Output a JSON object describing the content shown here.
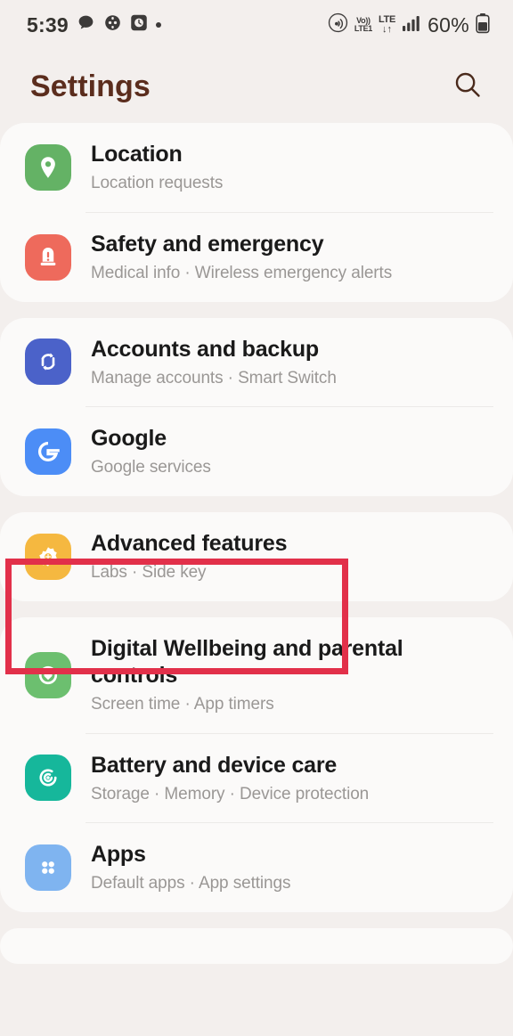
{
  "statusbar": {
    "time": "5:39",
    "left_icons": [
      "chat-bubble-icon",
      "game-controller-icon",
      "clock-app-icon",
      "dot-indicator-icon"
    ],
    "volte_top": "Vo))",
    "volte_bottom": "LTE1",
    "lte_top": "LTE",
    "lte_bottom": "↓↑",
    "signal_icon": "signal-bars-icon",
    "battery_percent": "60%",
    "battery_icon": "battery-icon",
    "hotspot_icon": "wifi-calling-icon"
  },
  "header": {
    "title": "Settings",
    "title_color": "#5b2d1d",
    "search_icon": "search-icon"
  },
  "groups": [
    {
      "id": "group-privacy",
      "items": [
        {
          "id": "location",
          "title": "Location",
          "subtitle": "Location requests",
          "icon": "location-pin-icon",
          "icon_color": "#64b265"
        },
        {
          "id": "safety-and-emergency",
          "title": "Safety and emergency",
          "subtitle": "Medical info  ·  Wireless emergency alerts",
          "icon": "emergency-siren-icon",
          "icon_color": "#ee6a5c"
        }
      ]
    },
    {
      "id": "group-accounts",
      "items": [
        {
          "id": "accounts-and-backup",
          "title": "Accounts and backup",
          "subtitle": "Manage accounts  ·  Smart Switch",
          "icon": "sync-arrows-icon",
          "icon_color": "#4b62c9"
        },
        {
          "id": "google",
          "title": "Google",
          "subtitle": "Google services",
          "icon": "google-g-icon",
          "icon_color": "#4c8df6"
        }
      ]
    },
    {
      "id": "group-advanced",
      "items": [
        {
          "id": "advanced-features",
          "title": "Advanced features",
          "subtitle": "Labs  ·  Side key",
          "icon": "gear-icon",
          "icon_color": "#f5b840"
        }
      ]
    },
    {
      "id": "group-device",
      "items": [
        {
          "id": "digital-wellbeing",
          "title": "Digital Wellbeing and parental controls",
          "subtitle": "Screen time  ·  App timers",
          "icon": "wellbeing-heart-icon",
          "icon_color": "#6cbf6f"
        },
        {
          "id": "battery-and-device-care",
          "title": "Battery and device care",
          "subtitle": "Storage  ·  Memory  ·  Device protection",
          "icon": "device-care-icon",
          "icon_color": "#16b79b"
        },
        {
          "id": "apps",
          "title": "Apps",
          "subtitle": "Default apps  ·  App settings",
          "icon": "apps-grid-icon",
          "icon_color": "#7fb4f0"
        }
      ]
    }
  ],
  "annotation": {
    "target": "advanced-features",
    "color": "#e2304a",
    "label": "highlight-box"
  }
}
